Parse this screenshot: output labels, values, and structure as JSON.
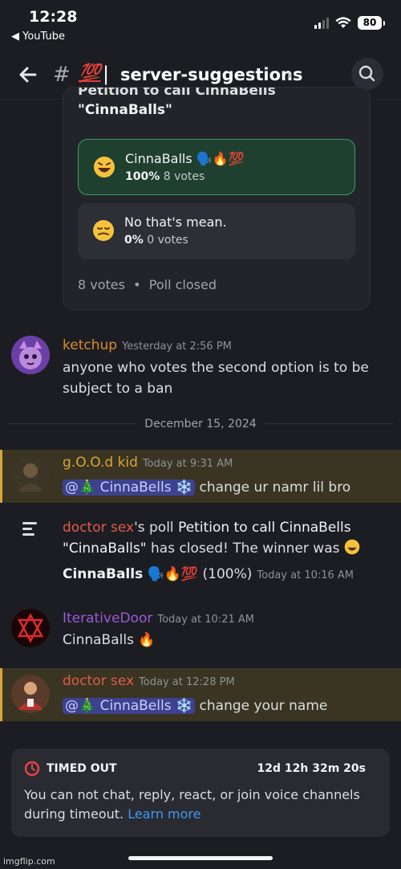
{
  "status": {
    "time": "12:28",
    "back_app": "◀ YouTube",
    "battery": "80"
  },
  "header": {
    "hash": "#",
    "emoji": "💯",
    "separator": "|",
    "channel": "server-suggestions",
    "chevron": "›"
  },
  "poll": {
    "question_line1": "Petition to call CinnaBells",
    "question_line2": "\"CinnaBalls\"",
    "options": [
      {
        "label": "CinnaBalls",
        "emojis": "🗣️🔥💯",
        "percent": "100%",
        "votes": "8 votes"
      },
      {
        "label": "No that's mean.",
        "emojis": "",
        "percent": "0%",
        "votes": "0 votes"
      }
    ],
    "footer_votes": "8 votes",
    "footer_dot": "•",
    "footer_status": "Poll closed"
  },
  "messages": {
    "ketchup": {
      "author": "ketchup",
      "timestamp": "Yesterday at 2:56 PM",
      "line1": "anyone who votes the second option is to be",
      "line2": "subject to a ban"
    },
    "date_divider": "December 15, 2024",
    "good_kid": {
      "author": "g.O.O.d kid",
      "timestamp": "Today at 9:31 AM",
      "mention": "@🎄 CinnaBells ❄️",
      "text": "change ur namr lil bro"
    },
    "system": {
      "author": "doctor sex",
      "part1": "'s poll ",
      "poll_name": "Petition to call CinnaBells",
      "line2a": "\"CinnaBalls\"",
      "line2b": " has closed! The winner was",
      "winner": "CinnaBalls",
      "winner_emojis": "🗣️🔥💯",
      "percent": "(100%)",
      "timestamp": "Today at 10:16 AM"
    },
    "iterative": {
      "author": "IterativeDoor",
      "timestamp": "Today at 10:21 AM",
      "text": "CinnaBalls 🔥"
    },
    "doctor": {
      "author": "doctor sex",
      "timestamp": "Today at 12:28 PM",
      "mention": "@🎄 CinnaBells ❄️",
      "text": "change your name"
    }
  },
  "timeout": {
    "title": "TIMED OUT",
    "remaining": "12d 12h 32m 20s",
    "text": "You can not chat, reply, react, or join voice channels during timeout. ",
    "link": "Learn more"
  },
  "watermark": "imgflip.com",
  "colors": {
    "ketchup": "#d98b2b",
    "good_kid": "#d9a43a",
    "doctor": "#e05a4a",
    "iterative": "#9b59d6",
    "winner_bg": "#20402f",
    "winner_border": "#3c9c63",
    "mention_bg": "#3a3522"
  },
  "icons": [
    "back-arrow-icon",
    "search-icon",
    "laughing-emoji-icon",
    "sad-emoji-icon",
    "poll-icon",
    "timeout-icon"
  ]
}
